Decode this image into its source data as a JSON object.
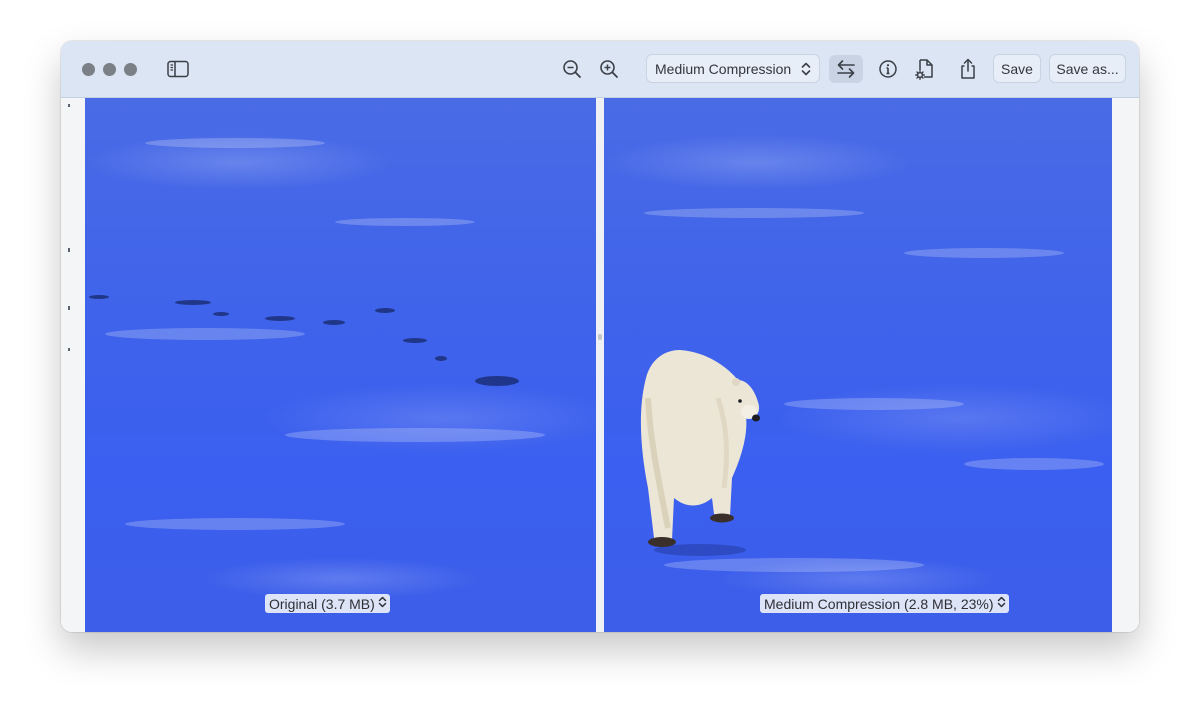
{
  "toolbar": {
    "compression_select": "Medium Compression",
    "save_label": "Save",
    "save_as_label": "Save as..."
  },
  "icons": {
    "sidebar": "sidebar-toggle-icon",
    "zoom_out": "zoom-out-icon",
    "zoom_in": "zoom-in-icon",
    "swap": "swap-arrows-icon",
    "info": "info-icon",
    "doc_settings": "document-gear-icon",
    "share": "share-icon"
  },
  "panes": {
    "left_label": "Original (3.7 MB)",
    "right_label": "Medium Compression (2.8 MB, 23%)"
  },
  "colors": {
    "toolbar_bg": "#dbe5f4",
    "snow_blue": "#3f63ea",
    "traffic_light": "#7b7f86"
  }
}
